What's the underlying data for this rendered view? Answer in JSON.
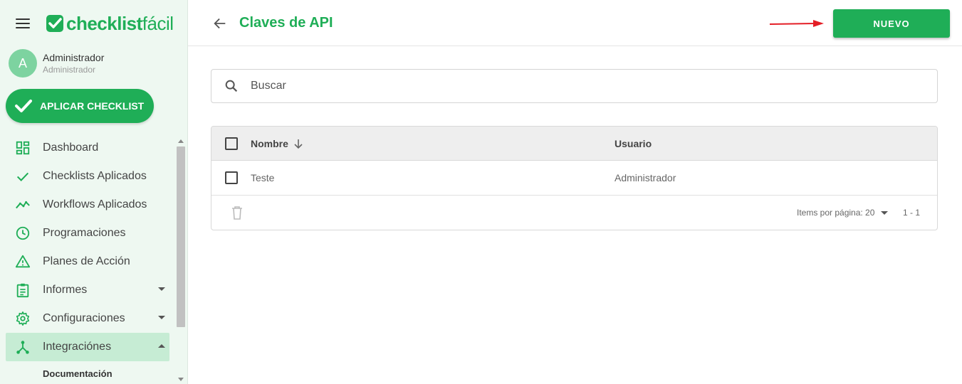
{
  "brand": {
    "name_bold": "checklist",
    "name_thin": "fácil",
    "color": "#1fae57"
  },
  "user": {
    "initial": "A",
    "name": "Administrador",
    "role": "Administrador"
  },
  "apply_button": {
    "label": "APLICAR CHECKLIST"
  },
  "sidebar": {
    "items": [
      {
        "label": "Dashboard",
        "icon": "dashboard-icon"
      },
      {
        "label": "Checklists Aplicados",
        "icon": "check-icon"
      },
      {
        "label": "Workflows Aplicados",
        "icon": "trending-icon"
      },
      {
        "label": "Programaciones",
        "icon": "clock-icon"
      },
      {
        "label": "Planes de Acción",
        "icon": "warning-icon"
      },
      {
        "label": "Informes",
        "icon": "clipboard-icon",
        "expandable": true
      },
      {
        "label": "Configuraciones",
        "icon": "gear-icon",
        "expandable": true
      },
      {
        "label": "Integraciónes",
        "icon": "hub-icon",
        "expandable": true,
        "active": true
      }
    ],
    "sub_items": [
      {
        "label": "Documentación"
      }
    ]
  },
  "header": {
    "title": "Claves de API",
    "new_button": "NUEVO"
  },
  "search": {
    "placeholder": "Buscar",
    "value": ""
  },
  "table": {
    "columns": {
      "name": "Nombre",
      "user": "Usuario"
    },
    "rows": [
      {
        "name": "Teste",
        "user": "Administrador"
      }
    ],
    "footer": {
      "items_per_page": "Items por página: 20",
      "range": "1 - 1"
    }
  }
}
